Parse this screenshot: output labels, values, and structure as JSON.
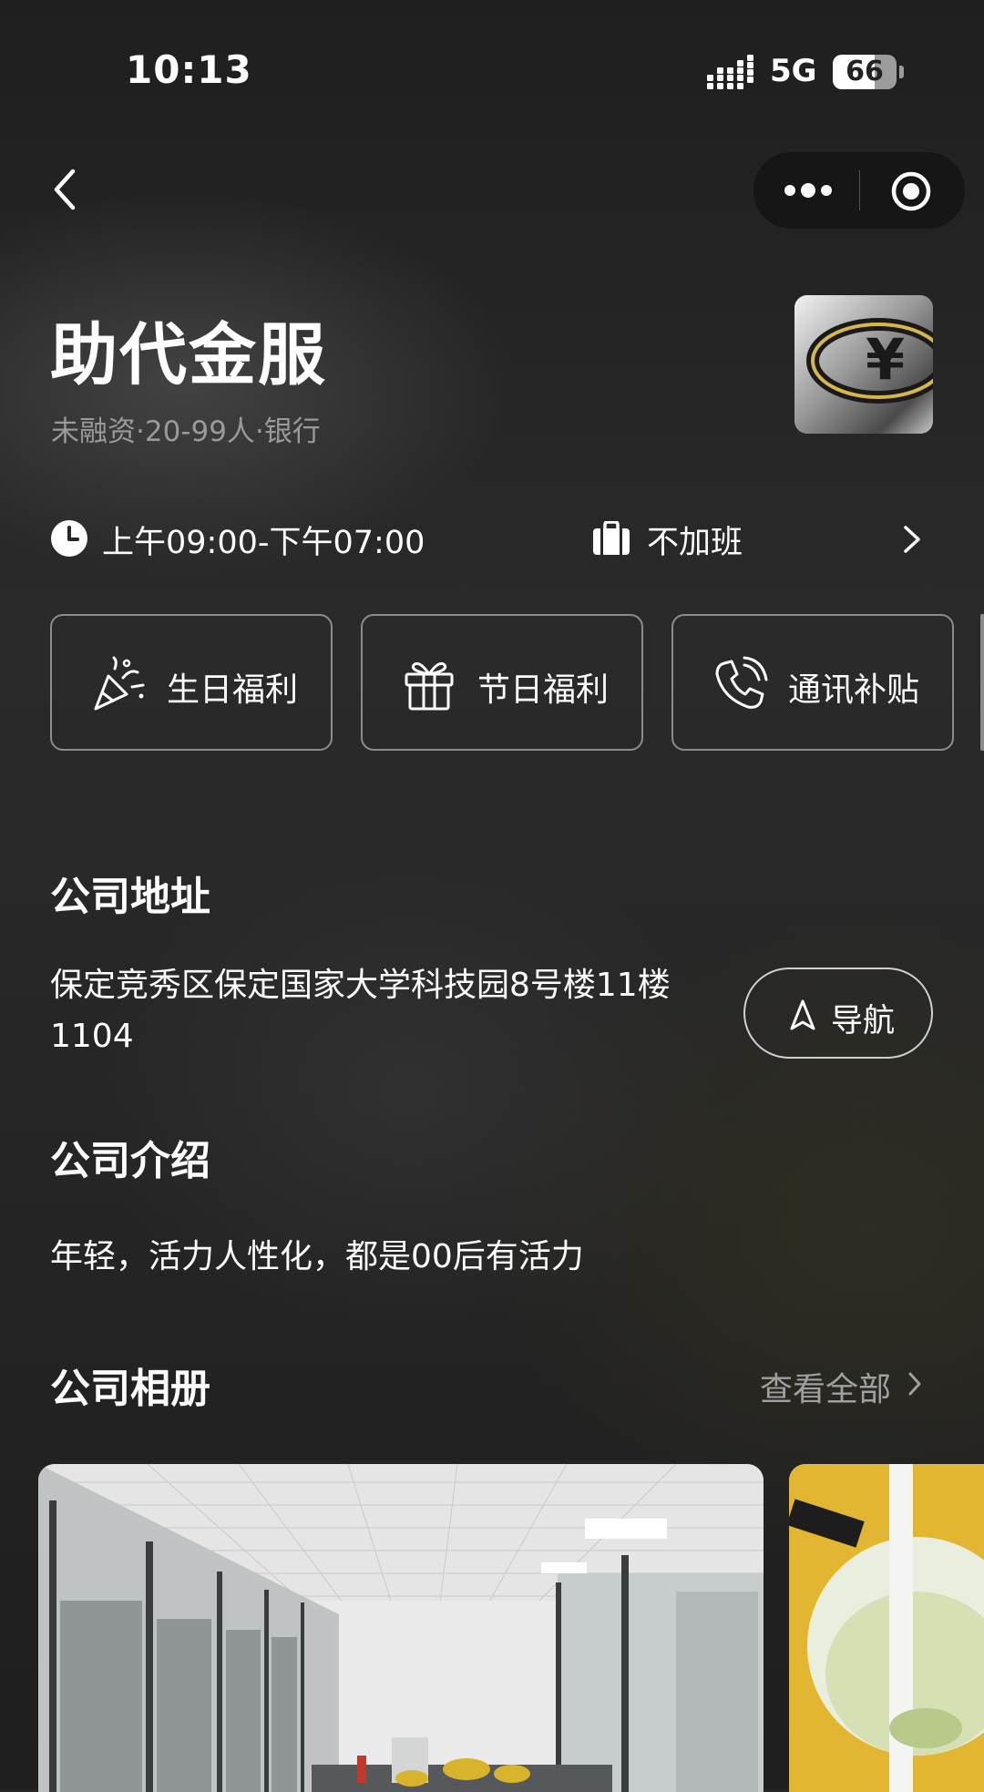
{
  "status_bar": {
    "time": "10:13",
    "network": "5G",
    "battery_level": "66",
    "battery_fraction": 0.66
  },
  "nav": {
    "back_icon": "chevron-left-icon",
    "more_icon": "more-dots-icon",
    "close_icon": "target-icon"
  },
  "company": {
    "name": "助代金服",
    "meta": "未融资·20-99人·银行",
    "logo_icon": "yen-logo"
  },
  "work": {
    "hours": "上午09:00-下午07:00",
    "overtime": "不加班"
  },
  "benefits": [
    {
      "label": "生日福利",
      "icon": "party-popper-icon"
    },
    {
      "label": "节日福利",
      "icon": "gift-icon"
    },
    {
      "label": "通讯补贴",
      "icon": "phone-icon"
    }
  ],
  "address": {
    "title": "公司地址",
    "line1": "保定竞秀区保定国家大学科技园8号楼11楼",
    "line2": "1104",
    "nav_label": "导航"
  },
  "intro": {
    "title": "公司介绍",
    "text": "年轻，活力人性化，都是00后有活力"
  },
  "album": {
    "title": "公司相册",
    "view_all": "查看全部"
  },
  "colors": {
    "background": "#262626",
    "text": "#ffffff",
    "muted": "#9a9a9a",
    "border": "#8c8c8c"
  }
}
